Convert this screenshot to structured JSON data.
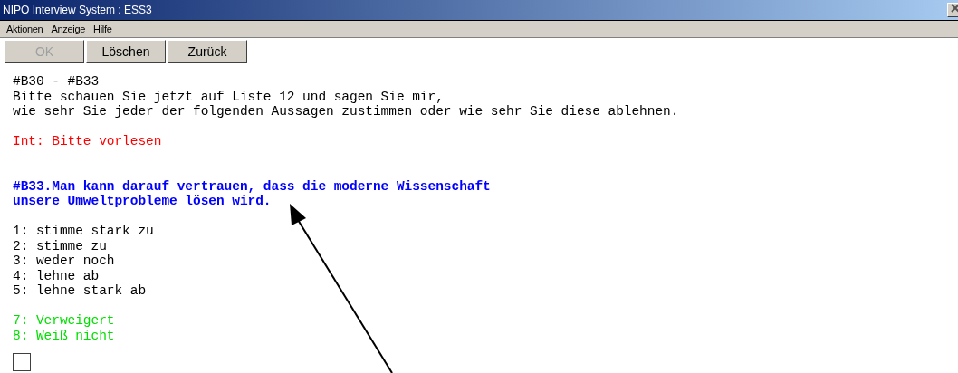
{
  "window": {
    "title": "NIPO Interview System : ESS3"
  },
  "menu": [
    "Aktionen",
    "Anzeige",
    "Hilfe"
  ],
  "buttons": [
    {
      "label": "OK",
      "disabled": true
    },
    {
      "label": "Löschen",
      "disabled": false
    },
    {
      "label": "Zurück",
      "disabled": false
    }
  ],
  "blocks": [
    {
      "kind": "text",
      "lines": [
        "#B30 - #B33",
        "Bitte schauen Sie jetzt auf Liste 12 und sagen Sie mir,",
        "wie sehr Sie jeder der folgenden Aussagen zustimmen oder wie sehr Sie diese ablehnen."
      ]
    },
    {
      "kind": "instruction",
      "lines": [
        "Int: Bitte vorlesen"
      ]
    },
    {
      "kind": "question",
      "lines": [
        "#B33.Man kann darauf vertrauen, dass die moderne Wissenschaft",
        "unsere Umweltprobleme lösen wird."
      ]
    },
    {
      "kind": "options",
      "lines": [
        "1: stimme stark zu",
        "2: stimme zu",
        "3: weder noch",
        "4: lehne ab",
        "5: lehne stark ab"
      ]
    },
    {
      "kind": "special",
      "lines": [
        "7: Verweigert",
        "8: Weiß nicht"
      ]
    }
  ]
}
